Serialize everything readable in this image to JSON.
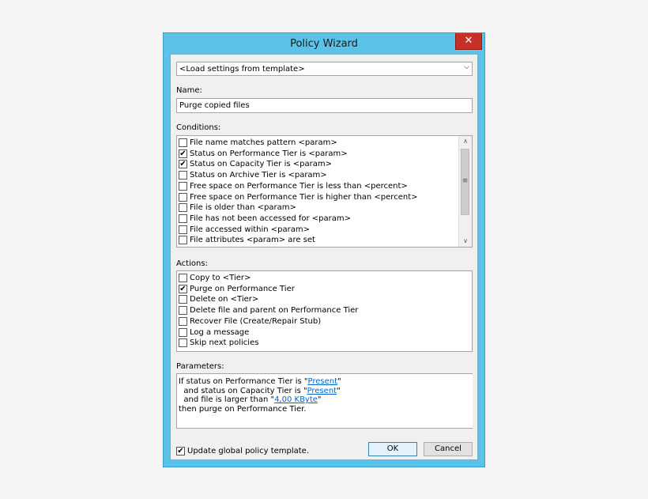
{
  "window": {
    "title": "Policy Wizard",
    "close_glyph": "✕"
  },
  "template": {
    "value": "<Load settings from template>"
  },
  "name": {
    "label": "Name:",
    "value": "Purge copied files"
  },
  "conditions": {
    "label": "Conditions:",
    "items": [
      {
        "label": "File name matches pattern <param>",
        "checked": false
      },
      {
        "label": "Status on Performance Tier is <param>",
        "checked": true
      },
      {
        "label": "Status on Capacity Tier is <param>",
        "checked": true
      },
      {
        "label": "Status on Archive Tier is <param>",
        "checked": false
      },
      {
        "label": "Free space on Performance Tier is less than <percent>",
        "checked": false
      },
      {
        "label": "Free space on Performance Tier is higher than <percent>",
        "checked": false
      },
      {
        "label": "File is older than <param>",
        "checked": false
      },
      {
        "label": "File has not been accessed for <param>",
        "checked": false
      },
      {
        "label": "File accessed within <param>",
        "checked": false
      },
      {
        "label": "File attributes <param> are set",
        "checked": false
      }
    ]
  },
  "actions": {
    "label": "Actions:",
    "items": [
      {
        "label": "Copy to <Tier>",
        "checked": false
      },
      {
        "label": "Purge on Performance Tier",
        "checked": true
      },
      {
        "label": "Delete on <Tier>",
        "checked": false
      },
      {
        "label": "Delete file and parent on Performance Tier",
        "checked": false
      },
      {
        "label": "Recover File (Create/Repair Stub)",
        "checked": false
      },
      {
        "label": "Log a message",
        "checked": false
      },
      {
        "label": "Skip next policies",
        "checked": false
      }
    ]
  },
  "parameters": {
    "label": "Parameters:",
    "line1_pre": "If status on Performance Tier is \"",
    "line1_link": "Present",
    "line1_post": "\"",
    "line2_pre": "  and status on Capacity Tier is \"",
    "line2_link": "Present",
    "line2_post": "\"",
    "line3_pre": "  and file is larger than \"",
    "line3_link": "4,00 KByte",
    "line3_post": "\"",
    "line4": "then purge on Performance Tier."
  },
  "footer": {
    "update_label": "Update global policy template.",
    "update_checked": true,
    "ok_label": "OK",
    "cancel_label": "Cancel"
  }
}
